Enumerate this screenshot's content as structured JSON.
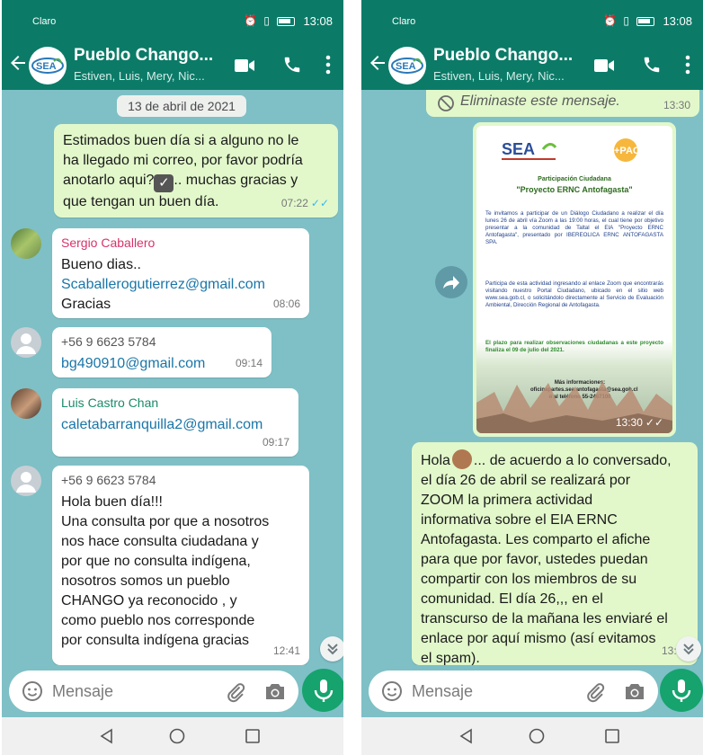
{
  "status_bar": {
    "carrier": "Claro",
    "time": "13:08"
  },
  "chat": {
    "title": "Pueblo Chango...",
    "subtitle": "Estiven, Luis, Mery, Nic...",
    "logo_text": "SEA"
  },
  "left": {
    "date_chip": "13 de abril de 2021",
    "msg1": {
      "text": "Estimados buen día si a alguno no le\nha llegado mi correo, por favor podría\nanotarlo aqui?",
      "text_end": ".. muchas gracias y\nque tengan un buen día.",
      "time": "07:22",
      "ticks": "✓✓"
    },
    "msg2": {
      "sender": "Sergio Caballero",
      "sender_color": "#d6336c",
      "line1": "Bueno dias..",
      "email": "Scaballerogutierrez@gmail.com",
      "line3": "Gracias",
      "time": "08:06"
    },
    "msg3": {
      "sender": "+56 9 6623 5784",
      "email": "bg490910@gmail.com",
      "time": "09:14"
    },
    "msg4": {
      "sender": "Luis Castro Chan",
      "sender_color": "#1b8a6b",
      "email": "caletabarranquilla2@gmail.com",
      "time": "09:17"
    },
    "msg5": {
      "sender": "+56 9 6623 5784",
      "text": "Hola buen día!!!\nUna consulta por que a nosotros\nnos hace consulta ciudadana y\npor que no consulta indígena,\nnosotros somos un pueblo\nCHANGO ya reconocido , y\ncomo pueblo  nos corresponde\npor consulta indígena  gracias",
      "time": "12:41"
    }
  },
  "right": {
    "deleted": {
      "text": "Eliminaste este mensaje.",
      "time": "13:30"
    },
    "poster": {
      "pac": "+PAC",
      "subtitle": "Participación Ciudadana",
      "title": "\"Proyecto ERNC Antofagasta\"",
      "para1": "Te invitamos a participar de un Diálogo Ciudadano a realizar el día lunes 26 de abril vía Zoom a las 19:00 horas, el cual tiene por objetivo presentar a la comunidad de Taltal el EIA \"Proyecto ERNC Antofagasta\", presentado por IBEREOLICA ERNC ANTOFAGASTA SPA.",
      "para2": "Participa de esta actividad ingresando al enlace Zoom que encontrarás visitando nuestro Portal Ciudadano, ubicado en el sitio web www.sea.gob.cl, o solicitándolo directamente al Servicio de Evaluación Ambiental, Dirección Regional de Antofagasta.",
      "para3": "El plazo para realizar observaciones ciudadanas a este proyecto finaliza el 09 de julio del 2021.",
      "more": "Más informaciones:\noficinapartes.sea.antofagasta@sea.gob.cl o al teléfono 55-2467100",
      "time": "13:30",
      "ticks": "✓✓"
    },
    "msg": {
      "text_start": "Hola",
      "text": "... de acuerdo a lo conversado,\nel día 26 de abril se realizará por\nZOOM la primera actividad\ninformativa sobre el EIA ERNC\nAntofagasta. Les comparto el afiche\npara que por favor, ustedes puedan\ncompartir con los miembros de su\ncomunidad. El día 26,,, en el\ntranscurso de la mañana les enviaré el\nenlace por aquí mismo (así evitamos\nel spam).",
      "time": "13:31"
    }
  },
  "input": {
    "placeholder": "Mensaje"
  },
  "icons": {
    "back": "arrow-left-icon",
    "video": "videocam-icon",
    "call": "phone-icon",
    "menu": "more-vert-icon",
    "emoji": "emoji-icon",
    "attach": "paperclip-icon",
    "camera": "camera-icon",
    "mic": "mic-icon",
    "share": "forward-icon",
    "scroll": "double-chevron-down-icon"
  },
  "colors": {
    "header": "#0b7b68",
    "wallpaper": "#7ec0c6",
    "outgoing_bubble": "#e2f8cb",
    "incoming_bubble": "#ffffff",
    "mic_button": "#16a36e",
    "read_ticks": "#34b7f1"
  }
}
